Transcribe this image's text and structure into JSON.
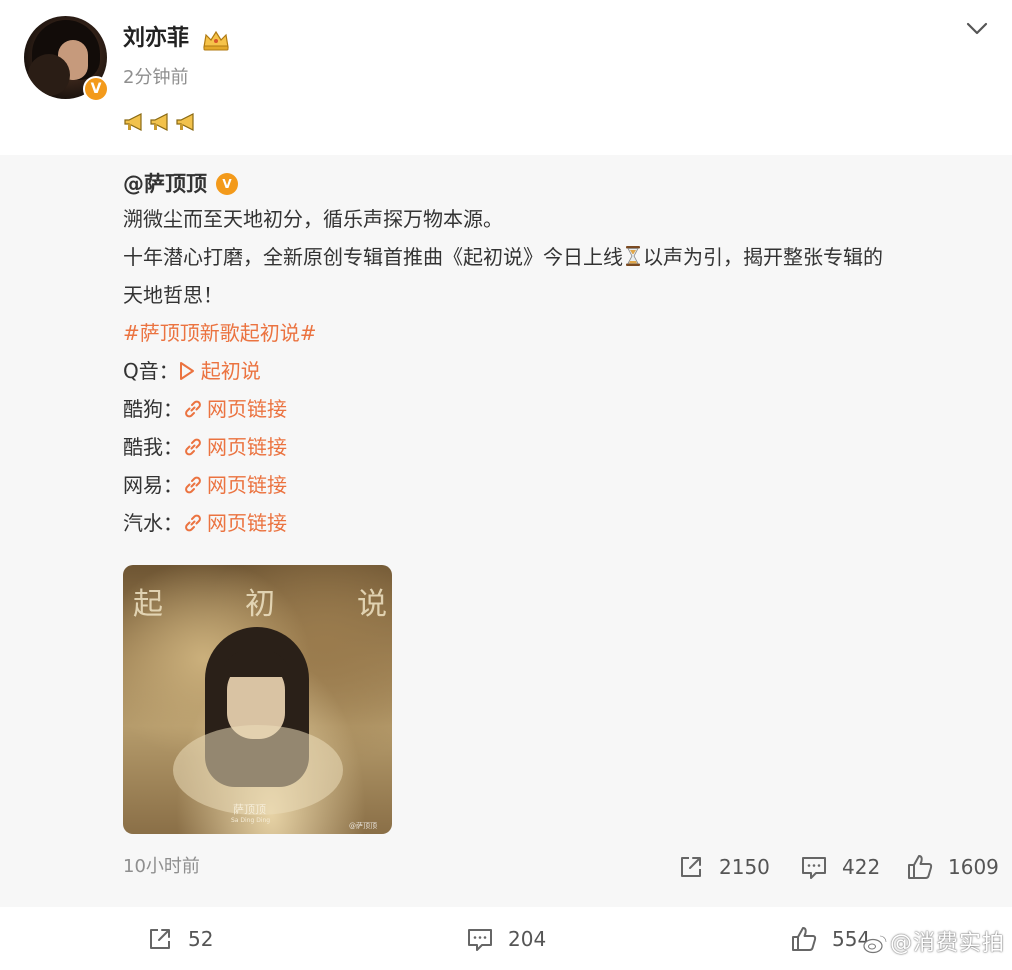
{
  "post": {
    "author": "刘亦菲",
    "time": "2分钟前",
    "icons": {
      "crown": "crown-icon",
      "verified": "verified-v-badge",
      "chevron": "chevron-down-icon",
      "megaphone": "megaphone-emoji"
    },
    "verified_label": "V",
    "megaphone_count": 3
  },
  "repost": {
    "author": "@萨顶顶",
    "verified_label": "V",
    "lines": [
      "溯微尘而至天地初分，循乐声探万物本源。",
      "十年潜心打磨，全新原创专辑首推曲《起初说》今日上线",
      "以声为引，揭开整张专辑的",
      "天地哲思！"
    ],
    "hashtag": "#萨顶顶新歌起初说#",
    "music_links": [
      {
        "platform": "Q音：",
        "link_text": "起初说",
        "icon": "play-icon"
      },
      {
        "platform": "酷狗：",
        "link_text": "网页链接",
        "icon": "link-icon"
      },
      {
        "platform": "酷我：",
        "link_text": "网页链接",
        "icon": "link-icon"
      },
      {
        "platform": "网易：",
        "link_text": "网页链接",
        "icon": "link-icon"
      },
      {
        "platform": "汽水：",
        "link_text": "网页链接",
        "icon": "link-icon"
      }
    ],
    "album": {
      "title_chars": [
        "起",
        "初",
        "说"
      ],
      "artist": "萨顶顶",
      "artist_en": "Sa Ding Ding",
      "watermark": "@萨顶顶"
    },
    "time": "10小时前",
    "stats": {
      "reposts": "2150",
      "comments": "422",
      "likes": "1609"
    }
  },
  "bottom_bar": {
    "reposts": "52",
    "comments": "204",
    "likes": "554",
    "watermark": "@消费实拍"
  },
  "colors": {
    "link": "#eb7340",
    "verified": "#f39a1b",
    "muted": "#8f8f8f",
    "repost_bg": "#f7f7f7"
  }
}
